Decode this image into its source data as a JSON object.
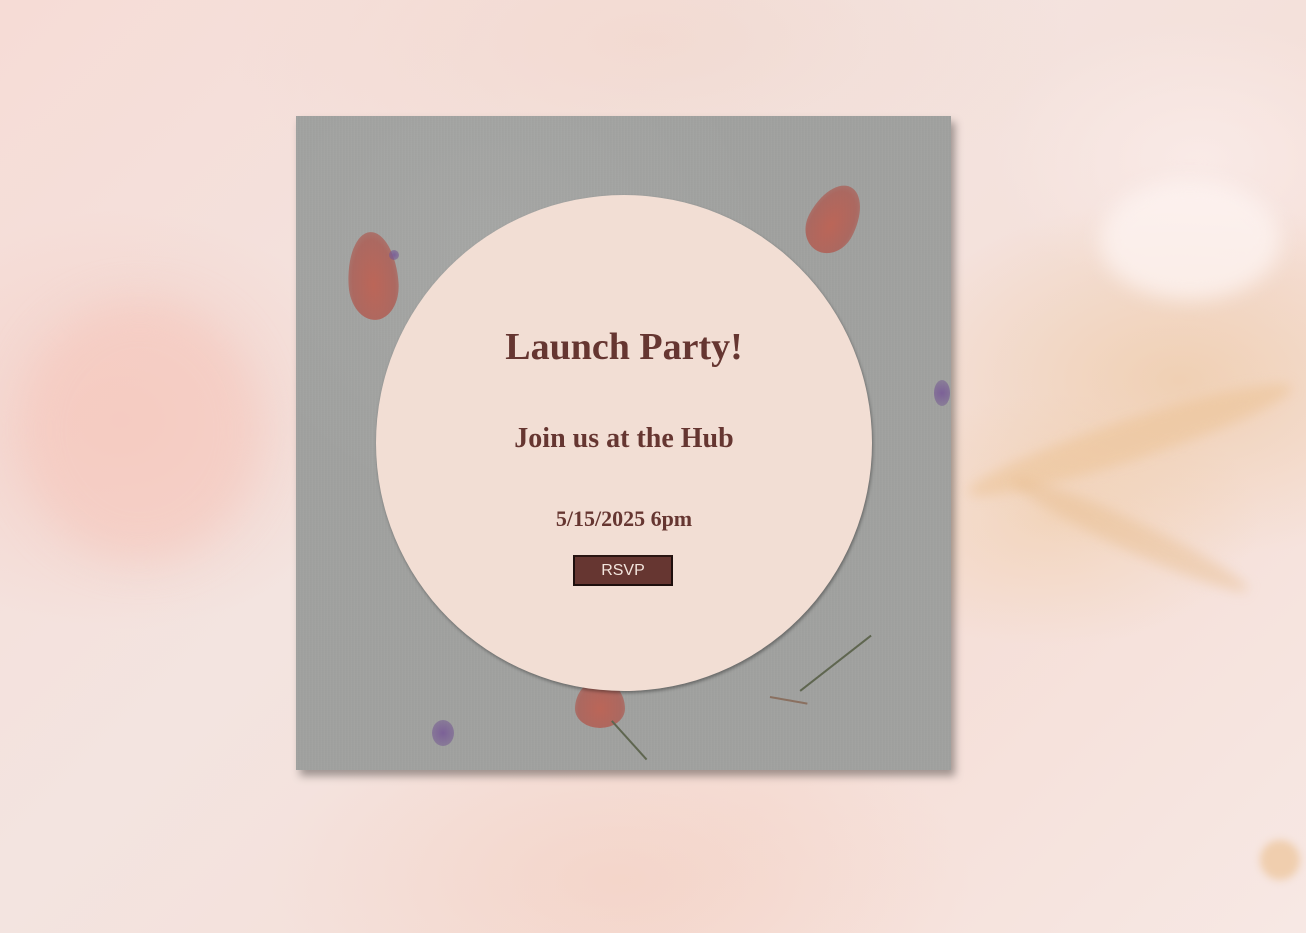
{
  "invitation": {
    "title": "Launch Party!",
    "subtitle": "Join us at the Hub",
    "datetime": "5/15/2025 6pm",
    "rsvp_label": "RSVP"
  },
  "colors": {
    "text": "#663631",
    "circle": "#f2ded4",
    "card": "#a2a3a1",
    "button_bg": "#663631",
    "button_text": "#f2e4dc"
  }
}
